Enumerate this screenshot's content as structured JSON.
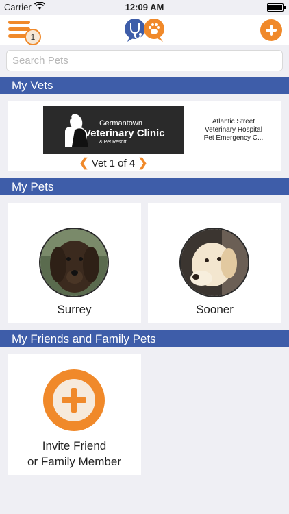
{
  "status_bar": {
    "carrier": "Carrier",
    "time": "12:09 AM"
  },
  "nav": {
    "menu_badge": "1"
  },
  "search": {
    "placeholder": "Search Pets"
  },
  "sections": {
    "vets": "My Vets",
    "pets": "My Pets",
    "friends": "My Friends and Family Pets"
  },
  "vets": {
    "banner": {
      "line1": "Germantown",
      "line2": "Veterinary Clinic",
      "line3": "& Pet Resort"
    },
    "pager": "Vet 1 of 4",
    "list": [
      "Atlantic Street",
      "Veterinary Hospital",
      "Pet Emergency C..."
    ]
  },
  "pets": [
    {
      "name": "Surrey"
    },
    {
      "name": "Sooner"
    }
  ],
  "invite": {
    "line1": "Invite Friend",
    "line2": "or Family Member"
  },
  "colors": {
    "accent": "#f0892a",
    "header": "#3e5da9",
    "background": "#efeff4"
  }
}
